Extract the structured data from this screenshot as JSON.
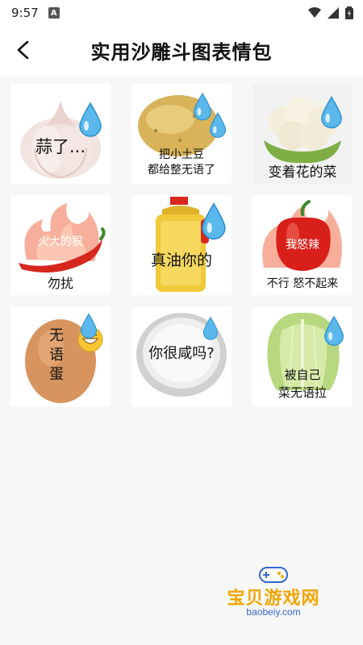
{
  "status": {
    "time": "9:57",
    "badge": "A"
  },
  "header": {
    "title": "实用沙雕斗图表情包"
  },
  "stickers": [
    {
      "subject": "garlic",
      "caption": "蒜了..."
    },
    {
      "subject": "potato",
      "caption_line1": "把小土豆",
      "caption_line2": "都给整无语了"
    },
    {
      "subject": "cauliflower",
      "caption": "变着花的菜"
    },
    {
      "subject": "chili-on-fire",
      "overlay": "火大的狠",
      "caption": "勿扰"
    },
    {
      "subject": "oil-bottle",
      "caption": "真油你的"
    },
    {
      "subject": "red-pepper-on-fire",
      "overlay": "我怒辣",
      "caption": "不行 怒不起来"
    },
    {
      "subject": "egg",
      "caption_line1": "无",
      "caption_line2": "语",
      "caption_line3": "蛋"
    },
    {
      "subject": "salt-bowl",
      "caption": "你很咸吗?"
    },
    {
      "subject": "cabbage",
      "caption_line1": "被自己",
      "caption_line2": "菜无语拉"
    }
  ],
  "watermark": {
    "text": "宝贝游戏网",
    "url": "baobeiy.com"
  }
}
